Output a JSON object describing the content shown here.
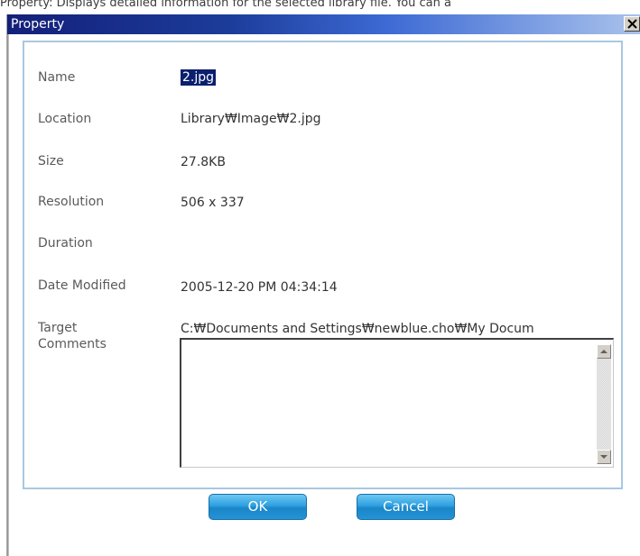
{
  "caption": "Property: Displays detailed information for the selected library file. You can a",
  "dialog": {
    "title": "Property"
  },
  "fields": {
    "name_label": "Name",
    "name_value": "2.jpg",
    "location_label": "Location",
    "location_value": "Library₩Image₩2.jpg",
    "size_label": "Size",
    "size_value": "27.8KB",
    "resolution_label": "Resolution",
    "resolution_value": "506 x 337",
    "duration_label": "Duration",
    "duration_value": "",
    "date_modified_label": "Date Modified",
    "date_modified_value": "2005-12-20 PM 04:34:14",
    "target_label": "Target",
    "target_value": "C:₩Documents and Settings₩newblue.cho₩My Docum",
    "comments_label": "Comments",
    "comments_value": ""
  },
  "buttons": {
    "ok_label": "OK",
    "cancel_label": "Cancel"
  },
  "colors": {
    "titlebar_start": "#13207a",
    "titlebar_end": "#a9c2ec",
    "panel_border": "#a8c8e0",
    "button": "#2e9fe0",
    "selection": "#0a1f6e"
  },
  "icons": {
    "close": "close-icon",
    "scroll_up": "arrow-up-icon",
    "scroll_down": "arrow-down-icon"
  }
}
